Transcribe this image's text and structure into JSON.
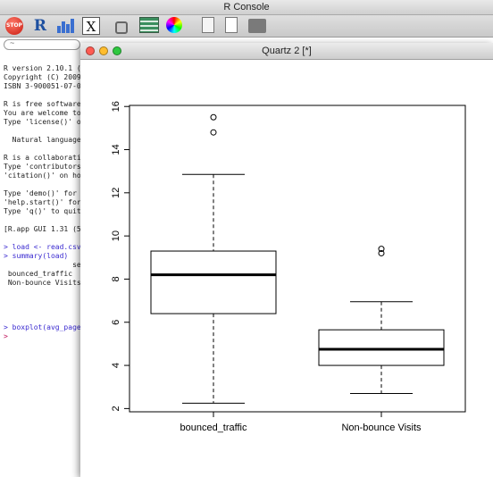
{
  "console": {
    "title": "R Console",
    "search_placeholder": "~",
    "lines": [
      {
        "text": "R version 2.10.1 (",
        "kind": "out"
      },
      {
        "text": "Copyright (C) 2009",
        "kind": "out"
      },
      {
        "text": "ISBN 3-900051-07-0",
        "kind": "out"
      },
      {
        "text": "",
        "kind": "out"
      },
      {
        "text": "R is free software",
        "kind": "out"
      },
      {
        "text": "You are welcome to",
        "kind": "out"
      },
      {
        "text": "Type 'license()' o",
        "kind": "out"
      },
      {
        "text": "",
        "kind": "out"
      },
      {
        "text": "  Natural language",
        "kind": "out"
      },
      {
        "text": "",
        "kind": "out"
      },
      {
        "text": "R is a collaborati",
        "kind": "out"
      },
      {
        "text": "Type 'contributors",
        "kind": "out"
      },
      {
        "text": "'citation()' on ho",
        "kind": "out"
      },
      {
        "text": "",
        "kind": "out"
      },
      {
        "text": "Type 'demo()' for ",
        "kind": "out"
      },
      {
        "text": "'help.start()' for",
        "kind": "out"
      },
      {
        "text": "Type 'q()' to quit",
        "kind": "out"
      },
      {
        "text": "",
        "kind": "out"
      },
      {
        "text": "[R.app GUI 1.31 (5",
        "kind": "out"
      },
      {
        "text": "",
        "kind": "out"
      },
      {
        "text": "> load <- read.csv",
        "kind": "cmd"
      },
      {
        "text": "> summary(load)",
        "kind": "cmd"
      },
      {
        "text": "                seg",
        "kind": "out"
      },
      {
        "text": " bounced_traffic",
        "kind": "out"
      },
      {
        "text": " Non-bounce Visits",
        "kind": "out"
      },
      {
        "text": "",
        "kind": "out"
      },
      {
        "text": "",
        "kind": "out"
      },
      {
        "text": "",
        "kind": "out"
      },
      {
        "text": "",
        "kind": "out"
      },
      {
        "text": "> boxplot(avg_page",
        "kind": "cmd"
      },
      {
        "text": ">",
        "kind": "prompt"
      }
    ]
  },
  "toolbar": {
    "stop_label": "STOP",
    "r_label": "R",
    "x11_label": "X",
    "icons": [
      "stop-icon",
      "r-source-icon",
      "bar-chart-icon",
      "x11-icon",
      "lock-icon",
      "list-icon",
      "color-wheel-icon",
      "edit-document-icon",
      "new-document-icon",
      "print-icon"
    ]
  },
  "quartz": {
    "title": "Quartz 2 [*]"
  },
  "chart_data": {
    "type": "boxplot",
    "title": "",
    "xlabel": "",
    "ylabel": "",
    "ylim": [
      1.85,
      16.05
    ],
    "yticks": [
      2,
      4,
      6,
      8,
      10,
      12,
      14,
      16
    ],
    "categories": [
      "bounced_traffic",
      "Non-bounce Visits"
    ],
    "boxes": [
      {
        "category": "bounced_traffic",
        "whisker_low": 2.25,
        "q1": 6.4,
        "median": 8.2,
        "q3": 9.3,
        "whisker_high": 12.85,
        "outliers": [
          14.8,
          15.5
        ]
      },
      {
        "category": "Non-bounce Visits",
        "whisker_low": 2.7,
        "q1": 4.0,
        "median": 4.75,
        "q3": 5.65,
        "whisker_high": 6.95,
        "outliers": [
          9.2,
          9.4
        ]
      }
    ],
    "grid": false,
    "legend": "none"
  }
}
